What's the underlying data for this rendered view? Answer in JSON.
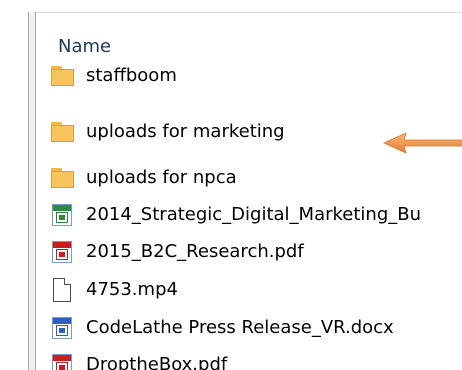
{
  "column_header": {
    "name_label": "Name"
  },
  "files": [
    {
      "name": "staffboom",
      "type": "folder",
      "icon": "folder-icon"
    },
    {
      "name": "uploads for marketing",
      "type": "folder",
      "icon": "folder-icon"
    },
    {
      "name": "uploads for npca",
      "type": "folder",
      "icon": "folder-icon"
    },
    {
      "name": "2014_Strategic_Digital_Marketing_Bu",
      "type": "xlsx",
      "icon": "excel-file-icon"
    },
    {
      "name": "2015_B2C_Research.pdf",
      "type": "pdf",
      "icon": "pdf-file-icon"
    },
    {
      "name": "4753.mp4",
      "type": "generic",
      "icon": "blank-file-icon"
    },
    {
      "name": "CodeLathe Press Release_VR.docx",
      "type": "docx",
      "icon": "word-file-icon"
    },
    {
      "name": "DroptheBox.pdf",
      "type": "pdf",
      "icon": "pdf-file-icon"
    }
  ],
  "annotation": {
    "icon": "orange-arrow-icon",
    "color": "#f39a4e",
    "points_to": "uploads for marketing"
  },
  "colors": {
    "header_text": "#1e395b",
    "folder": "#f7c45c",
    "arrow": "#f39a4e"
  }
}
